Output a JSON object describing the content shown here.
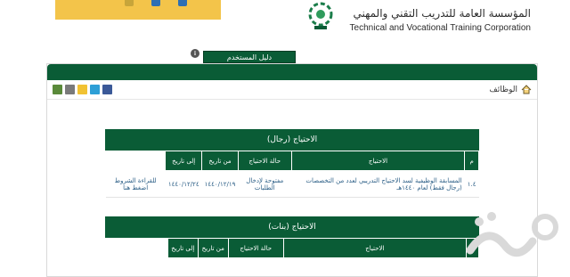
{
  "header": {
    "org_name_ar": "المؤسسة العامة للتدريب التقني والمهني",
    "org_name_en": "Technical and Vocational Training Corporation",
    "top_icon_colors": [
      "#c7a53a",
      "#2d6fb4",
      "#2d6fb4"
    ]
  },
  "breadcrumb": {
    "home_icon": "home-icon",
    "label": "الوظائف"
  },
  "share_icons": [
    {
      "name": "facebook-icon",
      "color": "#3b5998"
    },
    {
      "name": "twitter-icon",
      "color": "#2d9fd6"
    },
    {
      "name": "favorite-star-icon",
      "color": "#f1c232"
    },
    {
      "name": "print-icon",
      "color": "#7a7a7a"
    },
    {
      "name": "edit-icon",
      "color": "#5a8a3a"
    }
  ],
  "guide_button": {
    "label": "دليل المستخدم"
  },
  "men_section": {
    "title": "الاحتياج (رجال)",
    "columns": [
      "م",
      "الاحتياج",
      "حالة الاحتياج",
      "من تاريخ",
      "إلى تاريخ",
      ""
    ],
    "rows": [
      {
        "num": "١.٤",
        "need": "المسابقة الوظيفية لسد الاحتياج التدريبي لعدد من التخصصات (رجال فقط) لعام ١٤٤٠هـ",
        "status": "مفتوحة لإدخال الطلبات",
        "from": "١٤٤٠/١٢/١٩",
        "to": "١٤٤٠/١٢/٢٤",
        "action": "للقراءة الشروط اضغط هنا"
      }
    ]
  },
  "women_section": {
    "title": "الاحتياج (بنات)",
    "columns": [
      "م",
      "الاحتياج",
      "حالة الاحتياج",
      "من تاريخ",
      "إلى تاريخ",
      ""
    ]
  }
}
